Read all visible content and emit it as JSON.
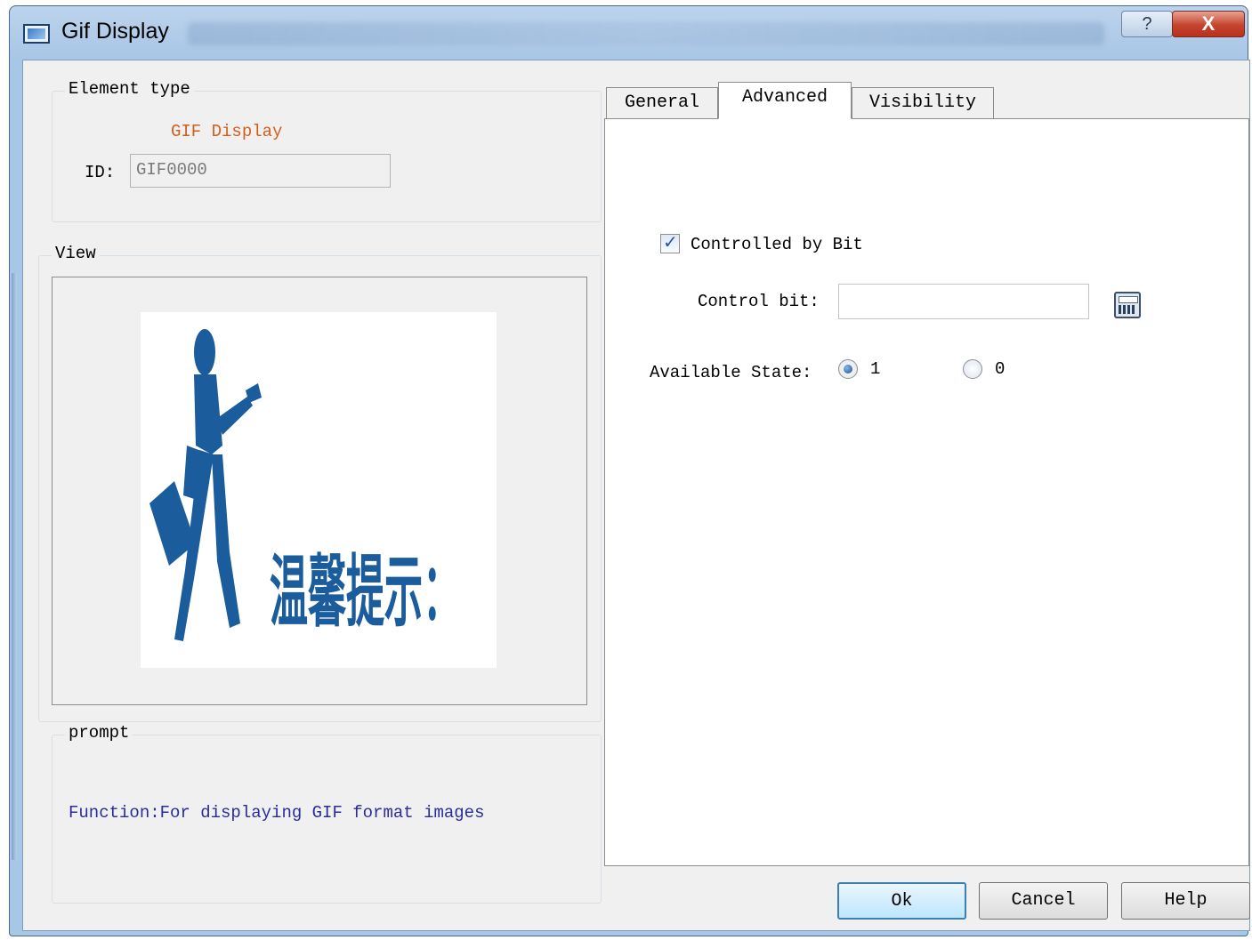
{
  "window": {
    "title": "Gif Display",
    "help_label": "?",
    "close_label": "X"
  },
  "element_type": {
    "group_label": "Element type",
    "value": "GIF Display",
    "id_label": "ID:",
    "id_value": "GIF0000"
  },
  "view": {
    "group_label": "View",
    "image_text": "温馨提示："
  },
  "prompt": {
    "group_label": "prompt",
    "text": "Function:For displaying GIF format images"
  },
  "tabs": [
    {
      "label": "General",
      "active": false
    },
    {
      "label": "Advanced",
      "active": true
    },
    {
      "label": "Visibility",
      "active": false
    }
  ],
  "advanced": {
    "controlled_by_bit_label": "Controlled by Bit",
    "controlled_by_bit_checked": true,
    "control_bit_label": "Control bit:",
    "control_bit_value": "",
    "available_state_label": "Available State:",
    "state_options": [
      {
        "label": "1",
        "selected": true
      },
      {
        "label": "0",
        "selected": false
      }
    ]
  },
  "buttons": {
    "ok": "Ok",
    "cancel": "Cancel",
    "help": "Help"
  },
  "colors": {
    "element_type_value": "#d25e1e",
    "prompt_text": "#2b2ba0",
    "image_blue": "#1a5c9c"
  },
  "icons": {
    "window_icon": "window-app-icon",
    "calculator": "calculator-icon"
  }
}
